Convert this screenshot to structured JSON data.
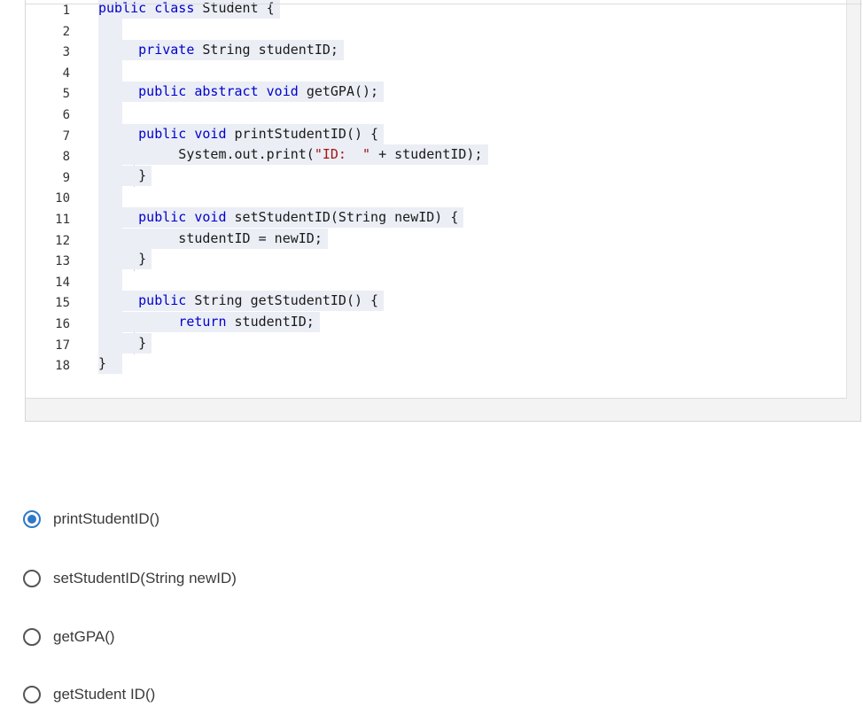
{
  "code": {
    "line_numbers": [
      "1",
      "2",
      "3",
      "4",
      "5",
      "6",
      "7",
      "8",
      "9",
      "10",
      "11",
      "12",
      "13",
      "14",
      "15",
      "16",
      "17",
      "18"
    ],
    "lines": [
      {
        "segments": [
          {
            "t": "public class ",
            "c": "kw"
          },
          {
            "t": "Student {",
            "c": "tx"
          }
        ]
      },
      {
        "segments": []
      },
      {
        "segments": [
          {
            "t": "     private ",
            "c": "kw"
          },
          {
            "t": "String studentID;",
            "c": "tx"
          }
        ]
      },
      {
        "segments": []
      },
      {
        "segments": [
          {
            "t": "     public abstract void ",
            "c": "kw"
          },
          {
            "t": "getGPA();",
            "c": "tx"
          }
        ]
      },
      {
        "segments": []
      },
      {
        "segments": [
          {
            "t": "     public void ",
            "c": "kw"
          },
          {
            "t": "printStudentID() {",
            "c": "tx"
          }
        ]
      },
      {
        "segments": [
          {
            "t": "          System.out.print(",
            "c": "tx"
          },
          {
            "t": "\"ID:  \"",
            "c": "st"
          },
          {
            "t": " + studentID);",
            "c": "tx"
          }
        ]
      },
      {
        "segments": [
          {
            "t": "     }",
            "c": "tx"
          }
        ]
      },
      {
        "segments": []
      },
      {
        "segments": [
          {
            "t": "     public void ",
            "c": "kw"
          },
          {
            "t": "setStudentID(String newID) {",
            "c": "tx"
          }
        ]
      },
      {
        "segments": [
          {
            "t": "          studentID = newID;",
            "c": "tx"
          }
        ]
      },
      {
        "segments": [
          {
            "t": "     }",
            "c": "tx"
          }
        ]
      },
      {
        "segments": []
      },
      {
        "segments": [
          {
            "t": "     public ",
            "c": "kw"
          },
          {
            "t": "String getStudentID() {",
            "c": "tx"
          }
        ]
      },
      {
        "segments": [
          {
            "t": "          ",
            "c": "tx"
          },
          {
            "t": "return ",
            "c": "kw"
          },
          {
            "t": "studentID;",
            "c": "tx"
          }
        ]
      },
      {
        "segments": [
          {
            "t": "     }",
            "c": "tx"
          }
        ]
      },
      {
        "segments": [
          {
            "t": "}",
            "c": "tx"
          }
        ]
      }
    ]
  },
  "options": [
    {
      "label": "printStudentID()",
      "checked": true
    },
    {
      "label": "setStudentID(String newID)",
      "checked": false
    },
    {
      "label": "getGPA()",
      "checked": false
    },
    {
      "label": "getStudent ID()",
      "checked": false
    }
  ],
  "colors": {
    "keyword": "#0000cc",
    "string": "#a31515",
    "radio_selected": "#2f78c8"
  }
}
